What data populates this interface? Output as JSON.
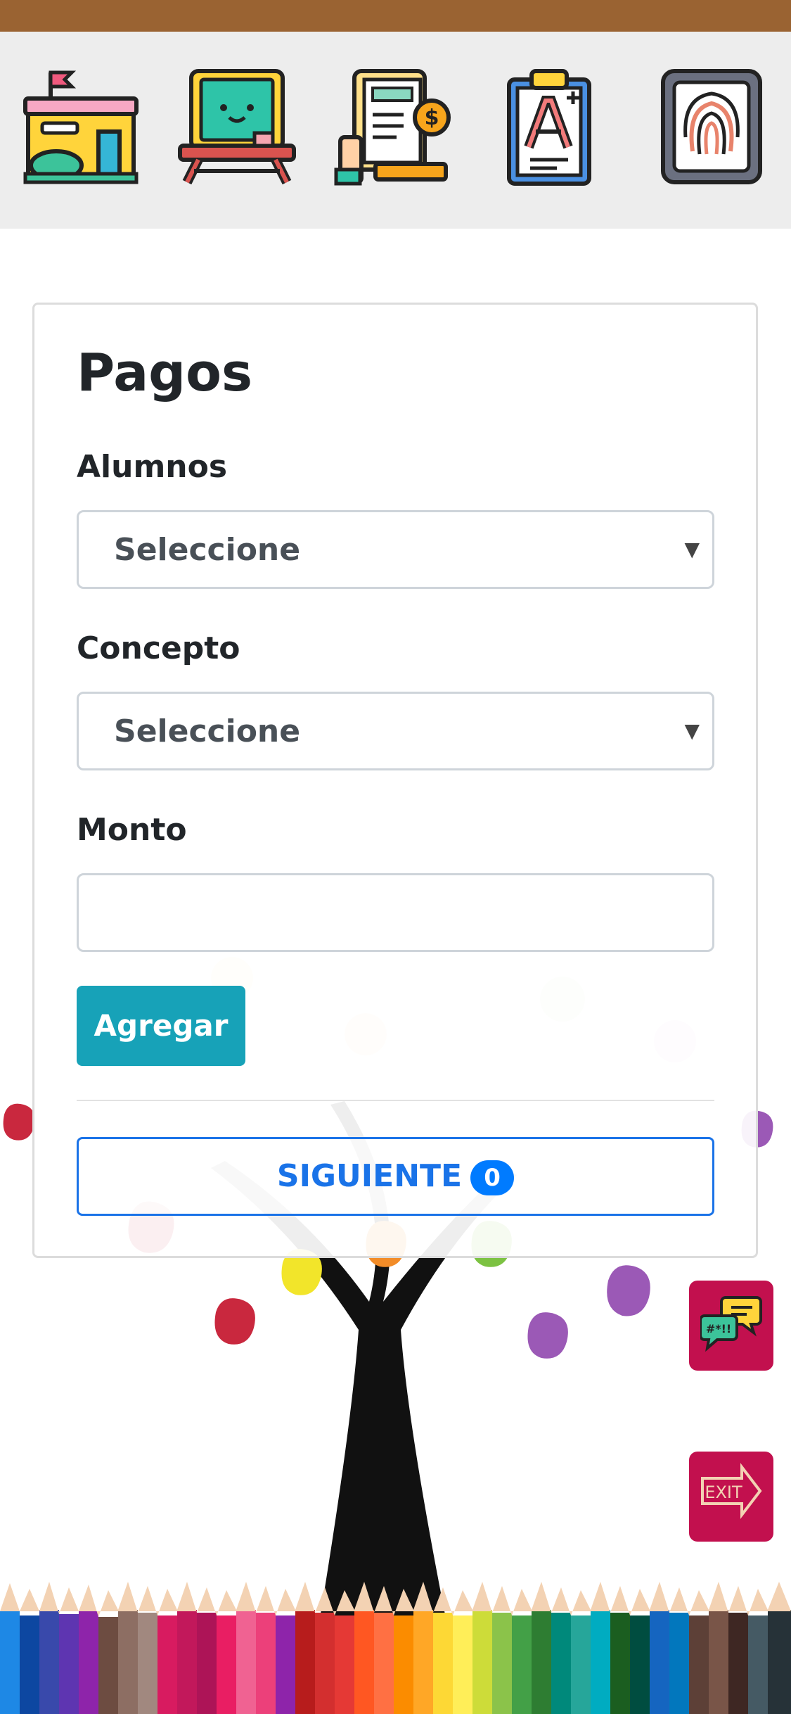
{
  "nav_icons": [
    {
      "name": "school-building-icon"
    },
    {
      "name": "classroom-desk-icon"
    },
    {
      "name": "invoice-payment-icon"
    },
    {
      "name": "grades-clipboard-icon"
    },
    {
      "name": "fingerprint-icon"
    }
  ],
  "form": {
    "title": "Pagos",
    "students_label": "Alumnos",
    "students_value": "Seleccione",
    "concept_label": "Concepto",
    "concept_value": "Seleccione",
    "amount_label": "Monto",
    "amount_value": "",
    "add_button": "Agregar",
    "next_button": "SIGUIENTE",
    "next_count": "0"
  },
  "colors": {
    "topbar": "#9a6332",
    "accent_teal": "#17a2b8",
    "accent_blue": "#1a73e8",
    "fab": "#c2104e"
  },
  "floating_buttons": {
    "chat": "chat-bubbles-icon",
    "exit": "EXIT"
  }
}
